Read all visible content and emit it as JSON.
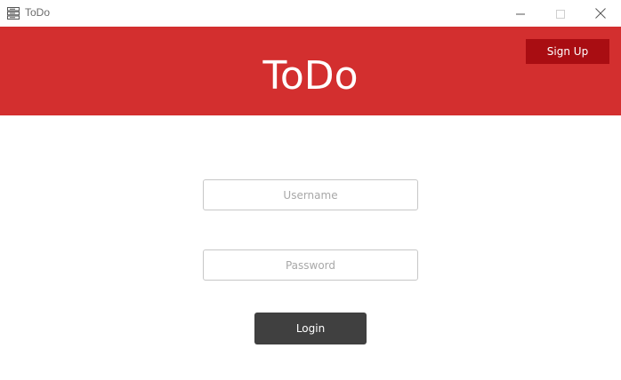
{
  "window": {
    "title": "ToDo",
    "icon": "list-app-icon",
    "controls": {
      "minimize_icon": "minimize-icon",
      "maximize_icon": "maximize-icon",
      "close_icon": "close-icon"
    }
  },
  "header": {
    "title": "ToDo",
    "signup_label": "Sign Up",
    "background_color": "#d32f2f",
    "signup_color": "#a90d12"
  },
  "form": {
    "username_placeholder": "Username",
    "username_value": "",
    "password_placeholder": "Password",
    "password_value": "",
    "login_label": "Login",
    "login_color": "#404040"
  }
}
